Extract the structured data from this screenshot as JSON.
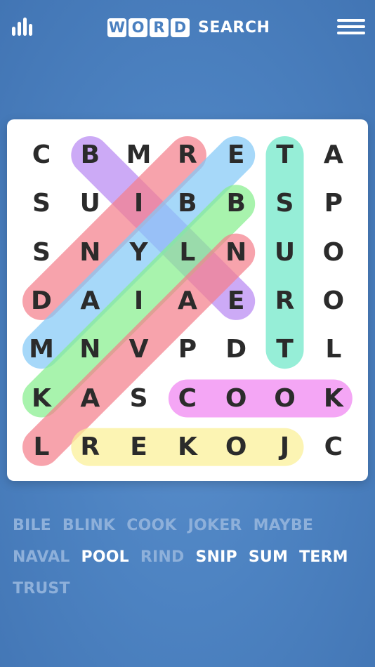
{
  "header": {
    "logo_tiles": [
      "W",
      "O",
      "R",
      "D"
    ],
    "logo_word": "SEARCH",
    "icons": {
      "left": "stats-icon",
      "right": "hamburger-menu-icon"
    }
  },
  "grid": [
    [
      "C",
      "B",
      "M",
      "R",
      "E",
      "T",
      "A"
    ],
    [
      "S",
      "U",
      "I",
      "B",
      "B",
      "S",
      "P"
    ],
    [
      "S",
      "N",
      "Y",
      "L",
      "N",
      "U",
      "O"
    ],
    [
      "D",
      "A",
      "I",
      "A",
      "E",
      "R",
      "O"
    ],
    [
      "M",
      "N",
      "V",
      "P",
      "D",
      "T",
      "L"
    ],
    [
      "K",
      "A",
      "S",
      "C",
      "O",
      "O",
      "K"
    ],
    [
      "L",
      "R",
      "E",
      "K",
      "O",
      "J",
      "C"
    ]
  ],
  "highlights": [
    {
      "word": "BLINK",
      "color": "#b889f2",
      "from": [
        0,
        1
      ],
      "to": [
        3,
        4
      ]
    },
    {
      "word": "RIND",
      "color": "#f47f8c",
      "from": [
        0,
        3
      ],
      "to": [
        3,
        0
      ]
    },
    {
      "word": "MAYBE",
      "color": "#84c9f6",
      "from": [
        4,
        0
      ],
      "to": [
        0,
        4
      ]
    },
    {
      "word": "BILE",
      "color": "#86ee8d",
      "from": [
        1,
        4
      ],
      "to": [
        5,
        0
      ]
    },
    {
      "word": "NAVAL",
      "color": "#f47f8c",
      "from": [
        2,
        4
      ],
      "to": [
        6,
        0
      ]
    },
    {
      "word": "TRUST",
      "color": "#6ee8c7",
      "from": [
        4,
        5
      ],
      "to": [
        0,
        5
      ]
    },
    {
      "word": "COOK",
      "color": "#f083f1",
      "from": [
        5,
        3
      ],
      "to": [
        5,
        6
      ]
    },
    {
      "word": "JOKER",
      "color": "#fbf095",
      "from": [
        6,
        5
      ],
      "to": [
        6,
        1
      ]
    }
  ],
  "words": {
    "rows": [
      [
        {
          "text": "BILE",
          "found": true
        },
        {
          "text": "BLINK",
          "found": true
        },
        {
          "text": "COOK",
          "found": true
        },
        {
          "text": "JOKER",
          "found": true
        },
        {
          "text": "MAYBE",
          "found": true
        }
      ],
      [
        {
          "text": "NAVAL",
          "found": true
        },
        {
          "text": "POOL",
          "found": false
        },
        {
          "text": "RIND",
          "found": true
        },
        {
          "text": "SNIP",
          "found": false
        },
        {
          "text": "SUM",
          "found": false
        },
        {
          "text": "TERM",
          "found": false
        }
      ],
      [
        {
          "text": "TRUST",
          "found": true
        }
      ]
    ]
  }
}
